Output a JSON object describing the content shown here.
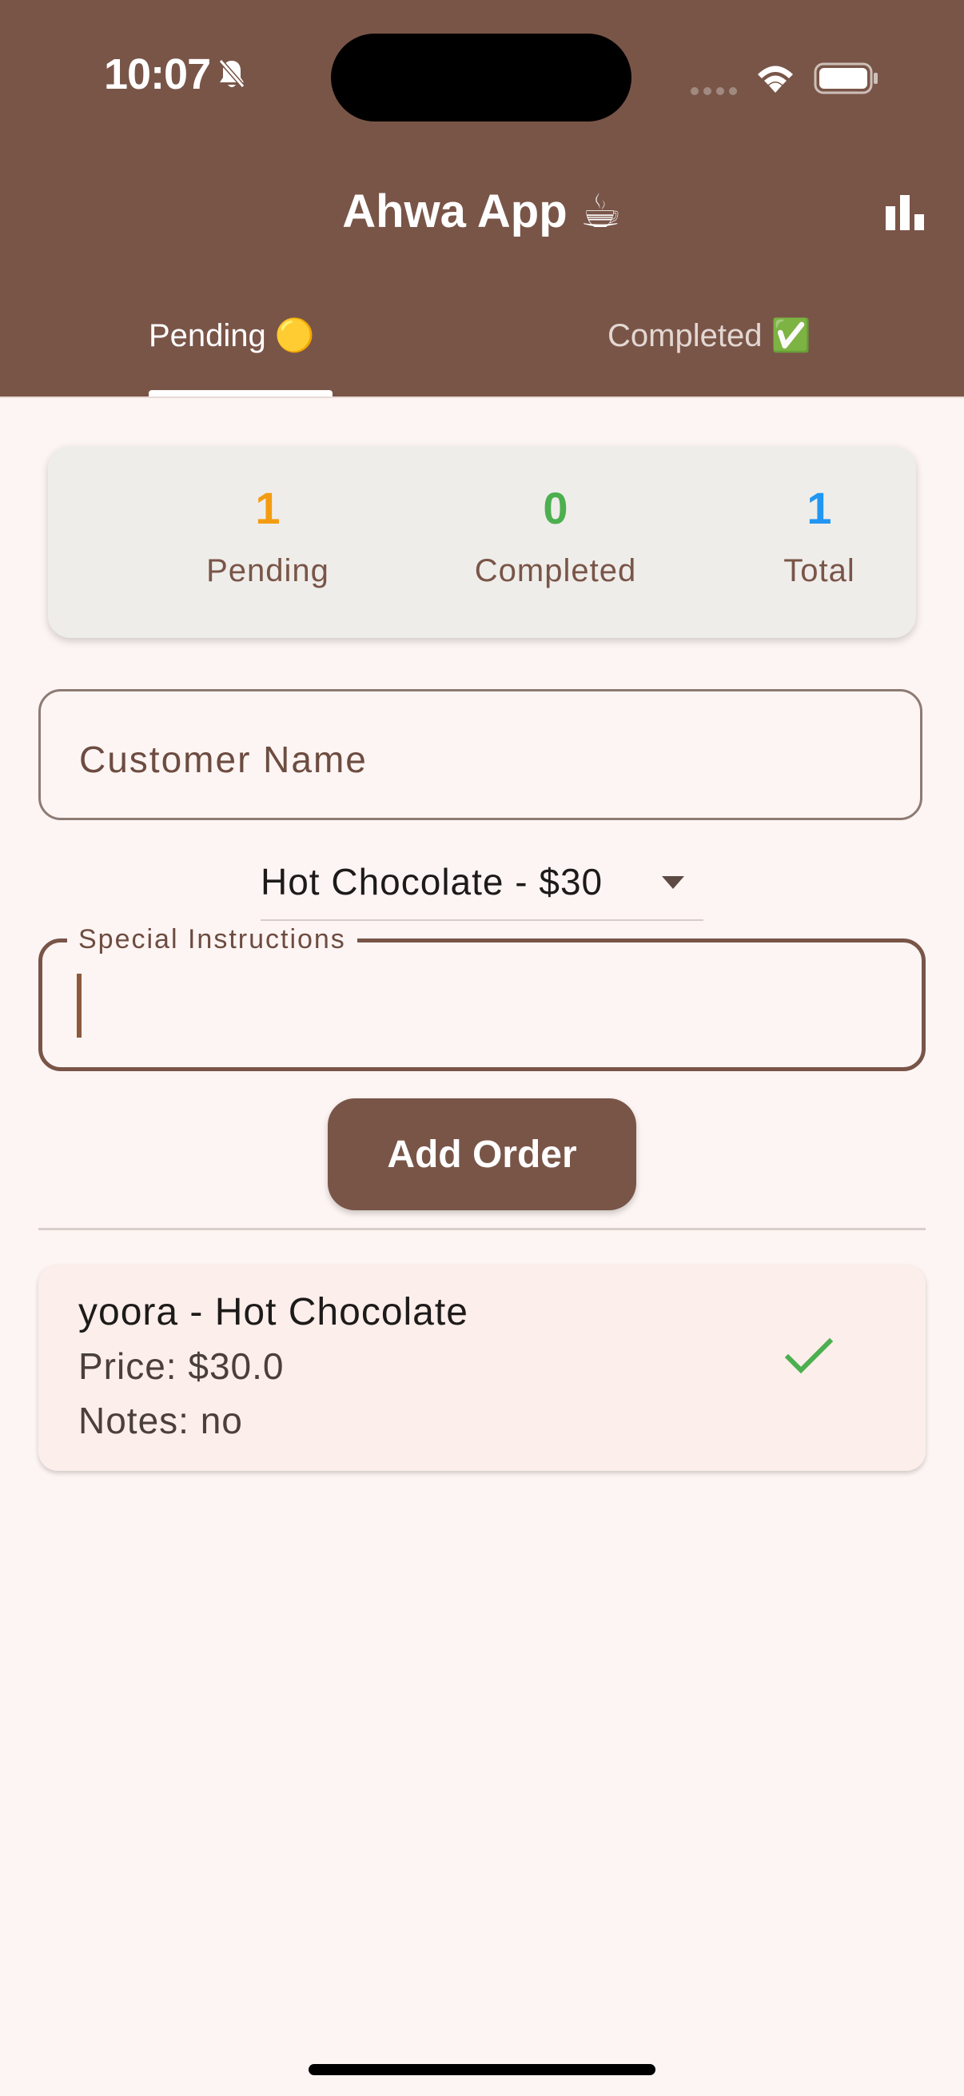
{
  "status_bar": {
    "time": "10:07"
  },
  "app_bar": {
    "title": "Ahwa App ☕"
  },
  "tabs": [
    {
      "label": "Pending 🟡"
    },
    {
      "label": "Completed ✅"
    }
  ],
  "summary": {
    "pending": {
      "count": "1",
      "label": "Pending",
      "color": "#F39C12"
    },
    "completed": {
      "count": "0",
      "label": "Completed",
      "color": "#4CAF50"
    },
    "total": {
      "count": "1",
      "label": "Total",
      "color": "#2196F3"
    }
  },
  "form": {
    "customer_name_placeholder": "Customer Name",
    "drink_selected": "Hot Chocolate - $30",
    "special_instructions_label": "Special Instructions",
    "special_instructions_value": "",
    "add_button_label": "Add Order"
  },
  "orders": [
    {
      "title": "yoora - Hot Chocolate",
      "price": "Price: $30.0",
      "notes": "Notes: no"
    }
  ],
  "colors": {
    "primary": "#795548",
    "background": "#FDF5F3",
    "card": "#FCEEEA",
    "check": "#4CAF50"
  },
  "icons": [
    "bell-slash-icon",
    "wifi-icon",
    "battery-icon",
    "bar-chart-icon",
    "dropdown-caret-icon",
    "check-icon"
  ]
}
